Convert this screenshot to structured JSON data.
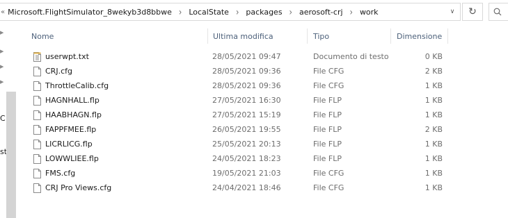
{
  "address_bar": {
    "prefix": "«",
    "crumbs": [
      "Microsoft.FlightSimulator_8wekyb3d8bbwe",
      "LocalState",
      "packages",
      "aerosoft-crj",
      "work"
    ],
    "separator": "›",
    "dropdown_glyph": "∨"
  },
  "toolbar": {
    "refresh_glyph": "↻",
    "search_icon": "search-icon"
  },
  "nav": {
    "fragments": [
      "C",
      "st"
    ]
  },
  "columns": {
    "name": "Nome",
    "date": "Ultima modifica",
    "type": "Tipo",
    "size": "Dimensione"
  },
  "colors": {
    "header_text": "#4c607a",
    "muted_text": "#6d6d6d",
    "icon_line": "#8a8a8a",
    "icon_accent": "#e3b44c"
  },
  "files": [
    {
      "name": "userwpt.txt",
      "date": "28/05/2021 09:47",
      "type": "Documento di testo",
      "size": "0 KB",
      "icon": "text-file-icon"
    },
    {
      "name": "CRJ.cfg",
      "date": "28/05/2021 09:36",
      "type": "File CFG",
      "size": "2 KB",
      "icon": "file-icon"
    },
    {
      "name": "ThrottleCalib.cfg",
      "date": "28/05/2021 09:36",
      "type": "File CFG",
      "size": "1 KB",
      "icon": "file-icon"
    },
    {
      "name": "HAGNHALL.flp",
      "date": "27/05/2021 16:30",
      "type": "File FLP",
      "size": "1 KB",
      "icon": "file-icon"
    },
    {
      "name": "HAABHAGN.flp",
      "date": "27/05/2021 15:19",
      "type": "File FLP",
      "size": "1 KB",
      "icon": "file-icon"
    },
    {
      "name": "FAPPFMEE.flp",
      "date": "26/05/2021 19:55",
      "type": "File FLP",
      "size": "2 KB",
      "icon": "file-icon"
    },
    {
      "name": "LICRLICG.flp",
      "date": "25/05/2021 20:13",
      "type": "File FLP",
      "size": "1 KB",
      "icon": "file-icon"
    },
    {
      "name": "LOWWLIEE.flp",
      "date": "24/05/2021 18:23",
      "type": "File FLP",
      "size": "1 KB",
      "icon": "file-icon"
    },
    {
      "name": "FMS.cfg",
      "date": "19/05/2021 21:03",
      "type": "File CFG",
      "size": "1 KB",
      "icon": "file-icon"
    },
    {
      "name": "CRJ Pro Views.cfg",
      "date": "24/04/2021 18:46",
      "type": "File CFG",
      "size": "1 KB",
      "icon": "file-icon"
    }
  ]
}
